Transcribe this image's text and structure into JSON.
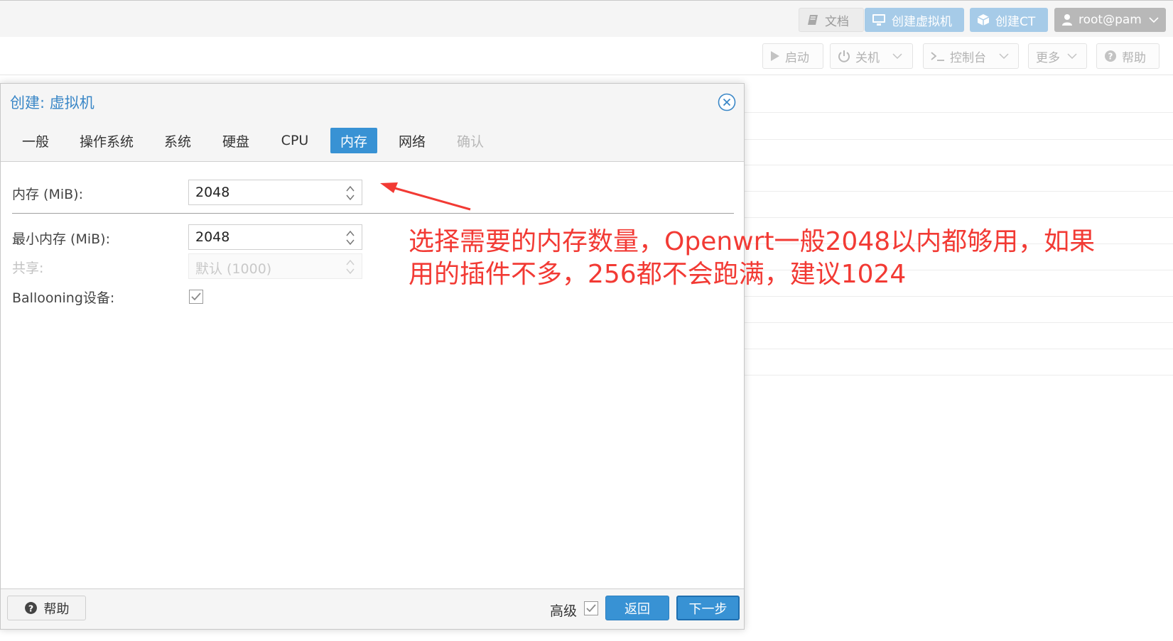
{
  "topbar": {
    "docs": "文档",
    "create_vm": "创建虚拟机",
    "create_ct": "创建CT",
    "user": "root@pam"
  },
  "toolbar": {
    "start": "启动",
    "shutdown": "关机",
    "console": "控制台",
    "more": "更多",
    "help": "帮助"
  },
  "dialog": {
    "title": "创建: 虚拟机",
    "tabs": [
      {
        "label": "一般"
      },
      {
        "label": "操作系统"
      },
      {
        "label": "系统"
      },
      {
        "label": "硬盘"
      },
      {
        "label": "CPU"
      },
      {
        "label": "内存"
      },
      {
        "label": "网络"
      },
      {
        "label": "确认"
      }
    ],
    "active_tab": "内存",
    "fields": {
      "memory_label": "内存 (MiB):",
      "memory_value": "2048",
      "min_memory_label": "最小内存 (MiB):",
      "min_memory_value": "2048",
      "shares_label": "共享:",
      "shares_placeholder": "默认 (1000)",
      "ballooning_label": "Ballooning设备:",
      "ballooning_checked": true
    },
    "footer": {
      "help": "帮助",
      "advanced": "高级",
      "advanced_checked": true,
      "back": "返回",
      "next": "下一步"
    }
  },
  "annotation": {
    "line1": "选择需要的内存数量，Openwrt一般2048以内都够用，如果",
    "line2": "用的插件不多，256都不会跑满，建议1024",
    "color": "#f23a34"
  },
  "colors": {
    "accent": "#3892d4",
    "title": "#3a87c7"
  }
}
